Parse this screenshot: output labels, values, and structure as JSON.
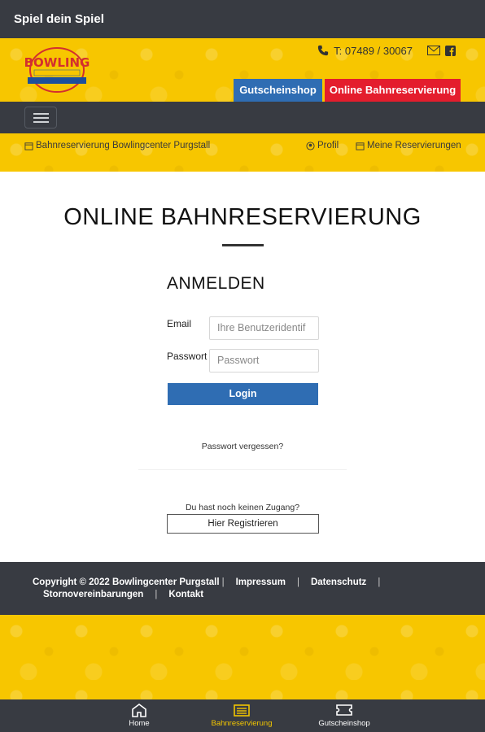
{
  "appbar": {
    "title": "Spiel dein Spiel"
  },
  "header": {
    "logo_text": "BOWLING",
    "logo_tagline": "Spiel Dein Spiel",
    "logo_subtitle": "Bowlingcenter Purgstall",
    "phone": "T: 07489 / 30067",
    "voucher_button": "Gutscheinshop",
    "online_button": "Online Bahnreservierung"
  },
  "subnav": {
    "reservation": "Bahnreservierung Bowlingcenter Purgstall",
    "profile": "Profil",
    "my_reservations": "Meine Reservierungen"
  },
  "main": {
    "title": "ONLINE BAHNRESERVIERUNG",
    "login_heading": "ANMELDEN",
    "email_label": "Email",
    "email_placeholder": "Ihre Benutzeridentif",
    "password_label": "Passwort",
    "password_placeholder": "Passwort",
    "login_button": "Login",
    "forgot_password": "Passwort vergessen?",
    "no_access": "Du hast noch keinen Zugang?",
    "register_button": "Hier Registrieren"
  },
  "footer": {
    "copyright": "Copyright © 2022 Bowlingcenter Purgstall",
    "imprint": "Impressum",
    "privacy": "Datenschutz",
    "cancellation": "Stornovereinbarungen",
    "contact": "Kontakt"
  },
  "bottom_nav": [
    {
      "label": "Home",
      "icon": "home-icon",
      "active": false
    },
    {
      "label": "Bahnreservierung",
      "icon": "reservation-icon",
      "active": true
    },
    {
      "label": "Gutscheinshop",
      "icon": "ticket-icon",
      "active": false
    }
  ],
  "colors": {
    "dark_bar": "#383b42",
    "yellow": "#f7c600",
    "blue": "#2f6db3",
    "red": "#e41d2d",
    "active_nav": "#f2c500"
  }
}
